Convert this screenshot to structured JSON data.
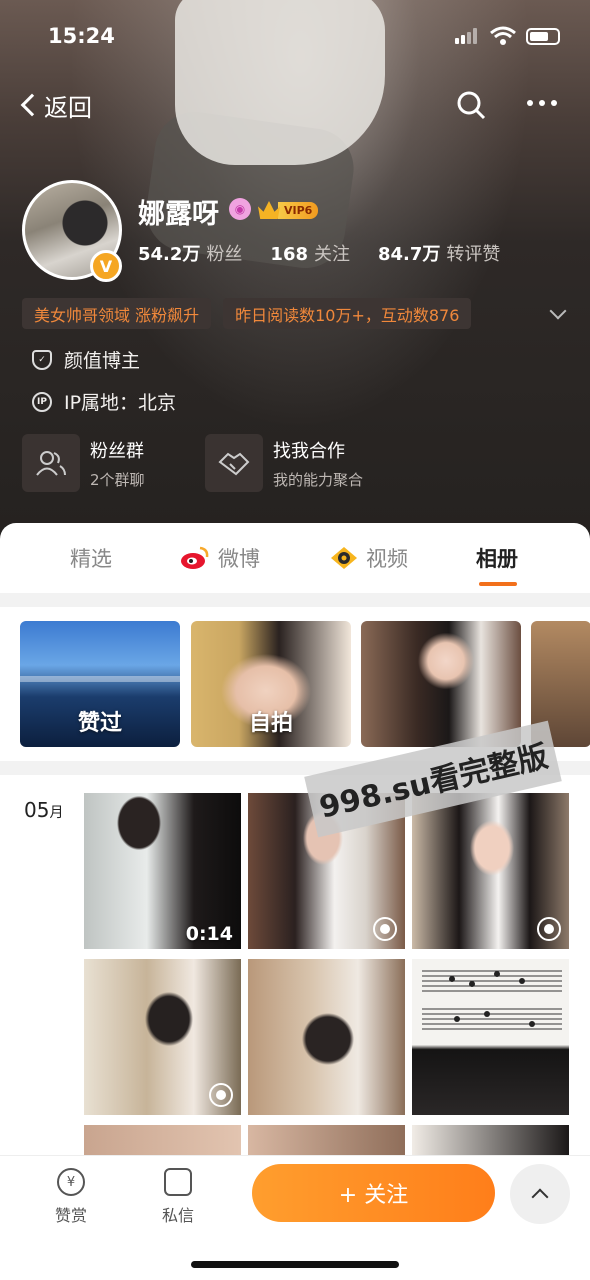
{
  "status_bar": {
    "time": "15:24"
  },
  "nav": {
    "back_label": "返回"
  },
  "profile": {
    "name": "娜露呀",
    "vip_label": "VIP6",
    "verified_badge": "V",
    "stats": [
      {
        "value": "54.2万",
        "label": "粉丝"
      },
      {
        "value": "168",
        "label": "关注"
      },
      {
        "value": "84.7万",
        "label": "转评赞"
      }
    ],
    "tags": [
      "美女帅哥领域 涨粉飙升",
      "昨日阅读数10万+，互动数876"
    ],
    "info": {
      "role": "颜值博主",
      "ip_icon": "IP",
      "ip_location": "IP属地：北京"
    },
    "cards": [
      {
        "title": "粉丝群",
        "subtitle": "2个群聊"
      },
      {
        "title": "找我合作",
        "subtitle": "我的能力聚合"
      }
    ]
  },
  "tabs": [
    {
      "label": "精选"
    },
    {
      "label": "微博"
    },
    {
      "label": "视频"
    },
    {
      "label": "相册"
    }
  ],
  "albums": [
    {
      "label": "赞过"
    },
    {
      "label": "自拍"
    },
    {
      "label": ""
    },
    {
      "label": ""
    }
  ],
  "photos": {
    "month": "05",
    "month_unit": "月",
    "video_duration": "0:14"
  },
  "watermark": "998.su看完整版",
  "bottom_bar": {
    "reward_label": "赞赏",
    "message_label": "私信",
    "follow_label": "+ 关注"
  },
  "colors": {
    "accent": "#ff8a1f",
    "tag_text": "#f0883b"
  }
}
